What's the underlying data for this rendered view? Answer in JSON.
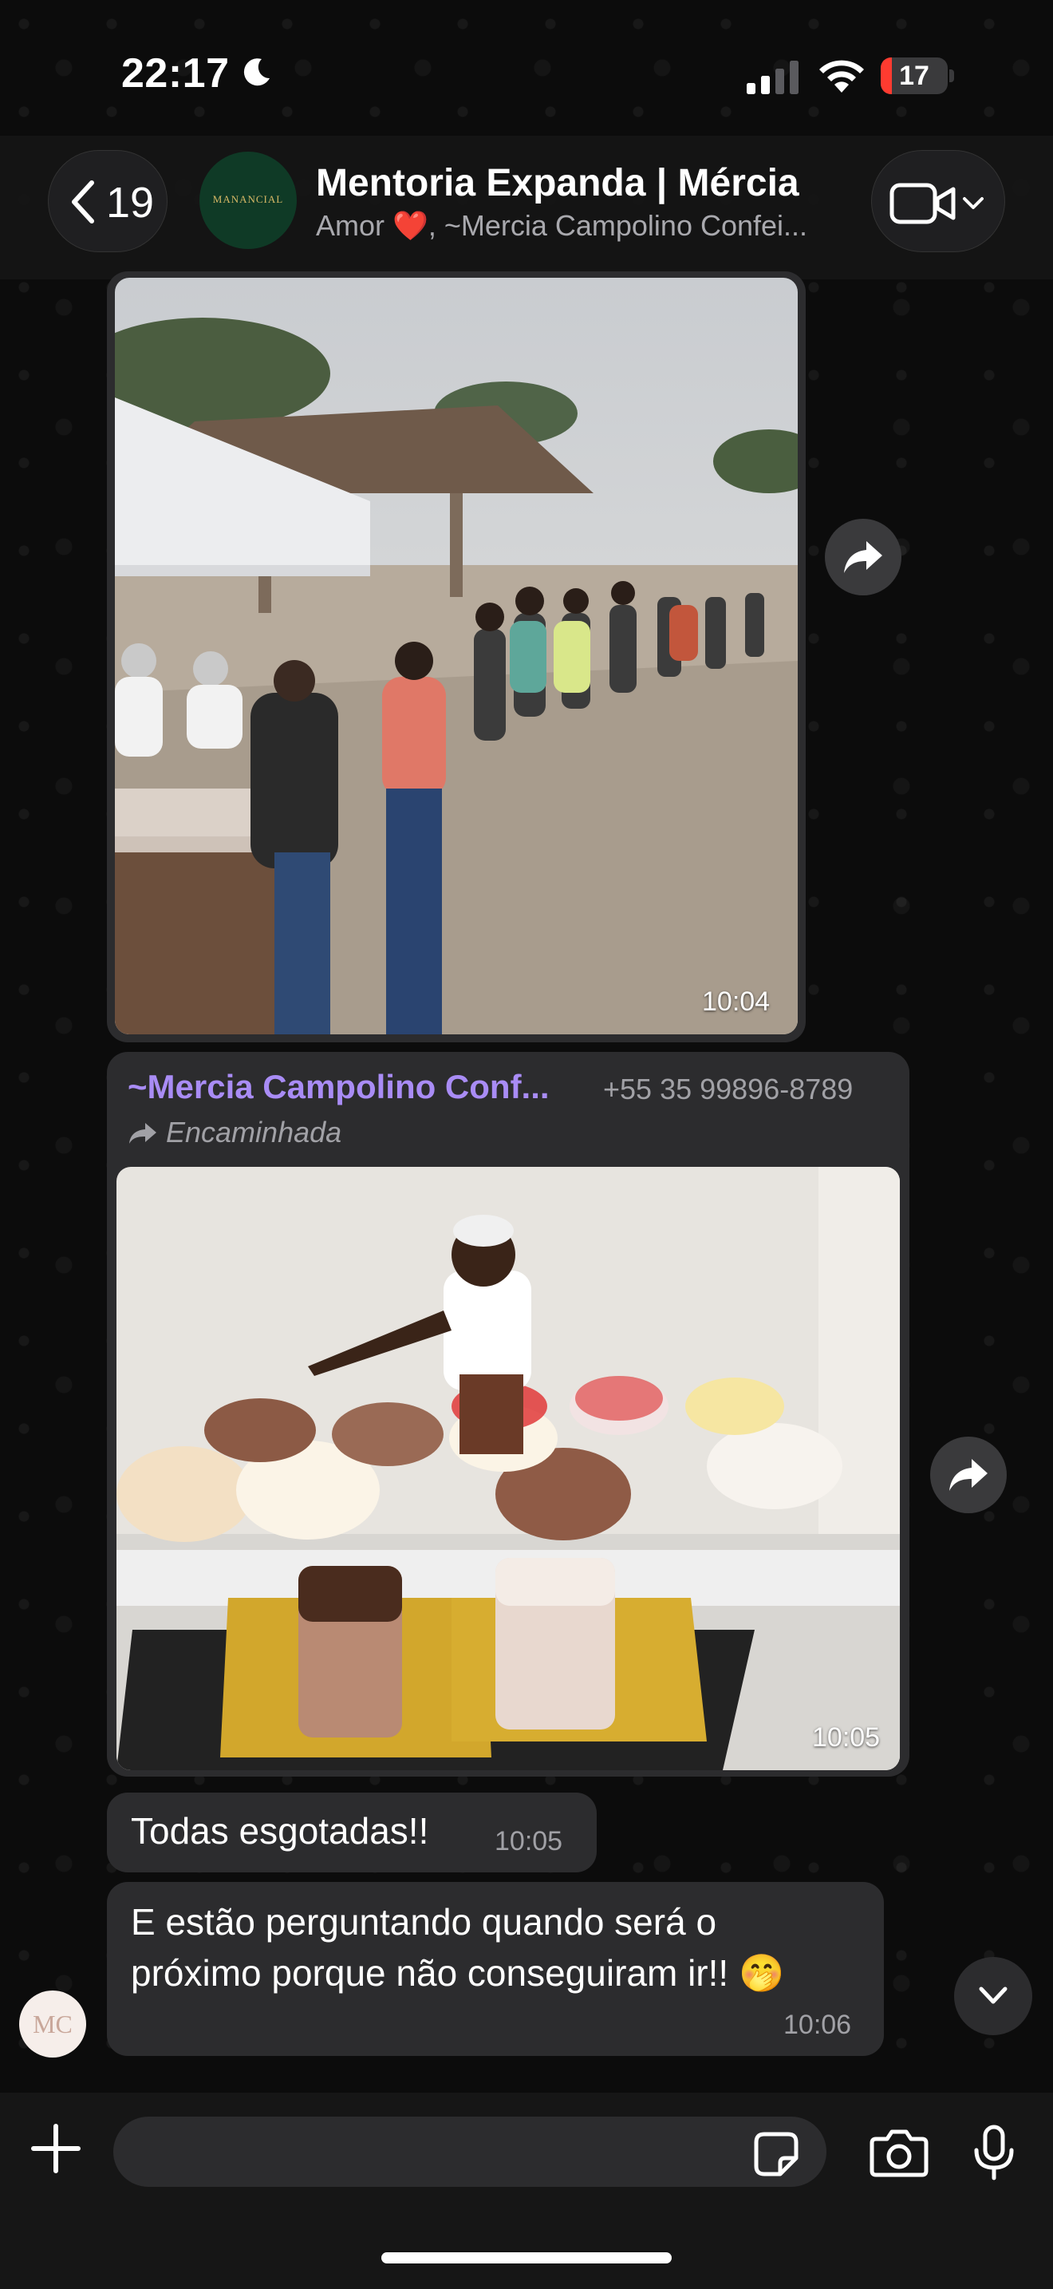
{
  "status_bar": {
    "time": "22:17",
    "battery": "17",
    "battery_level": 0.17,
    "icons": [
      "moon-icon",
      "cellular-signal-icon",
      "wifi-icon",
      "battery-icon"
    ]
  },
  "header": {
    "back_count": "19",
    "avatar_text": "MANANCIAL",
    "title": "Mentoria Expanda | Mércia",
    "subtitle": "Amor ❤️, ~Mercia Campolino Confei..."
  },
  "messages": {
    "photo1": {
      "time": "10:04"
    },
    "forwarded": {
      "sender": "~Mercia Campolino Conf...",
      "phone": "+55 35 99896-8789",
      "label": "Encaminhada",
      "time": "10:05"
    },
    "text1": {
      "text": "Todas esgotadas!!",
      "time": "10:05"
    },
    "text2": {
      "line1": "E estão perguntando quando será o",
      "line2": "próximo porque não conseguiram ir!! 🤭",
      "time": "10:06"
    }
  },
  "sender_avatar": {
    "text": "MC"
  },
  "input_bar": {
    "placeholder": ""
  },
  "colors": {
    "bubble": "#2c2c2e",
    "sender_name": "#a98cf5",
    "battery_low": "#ff3b30",
    "background": "#0c0c0c"
  }
}
